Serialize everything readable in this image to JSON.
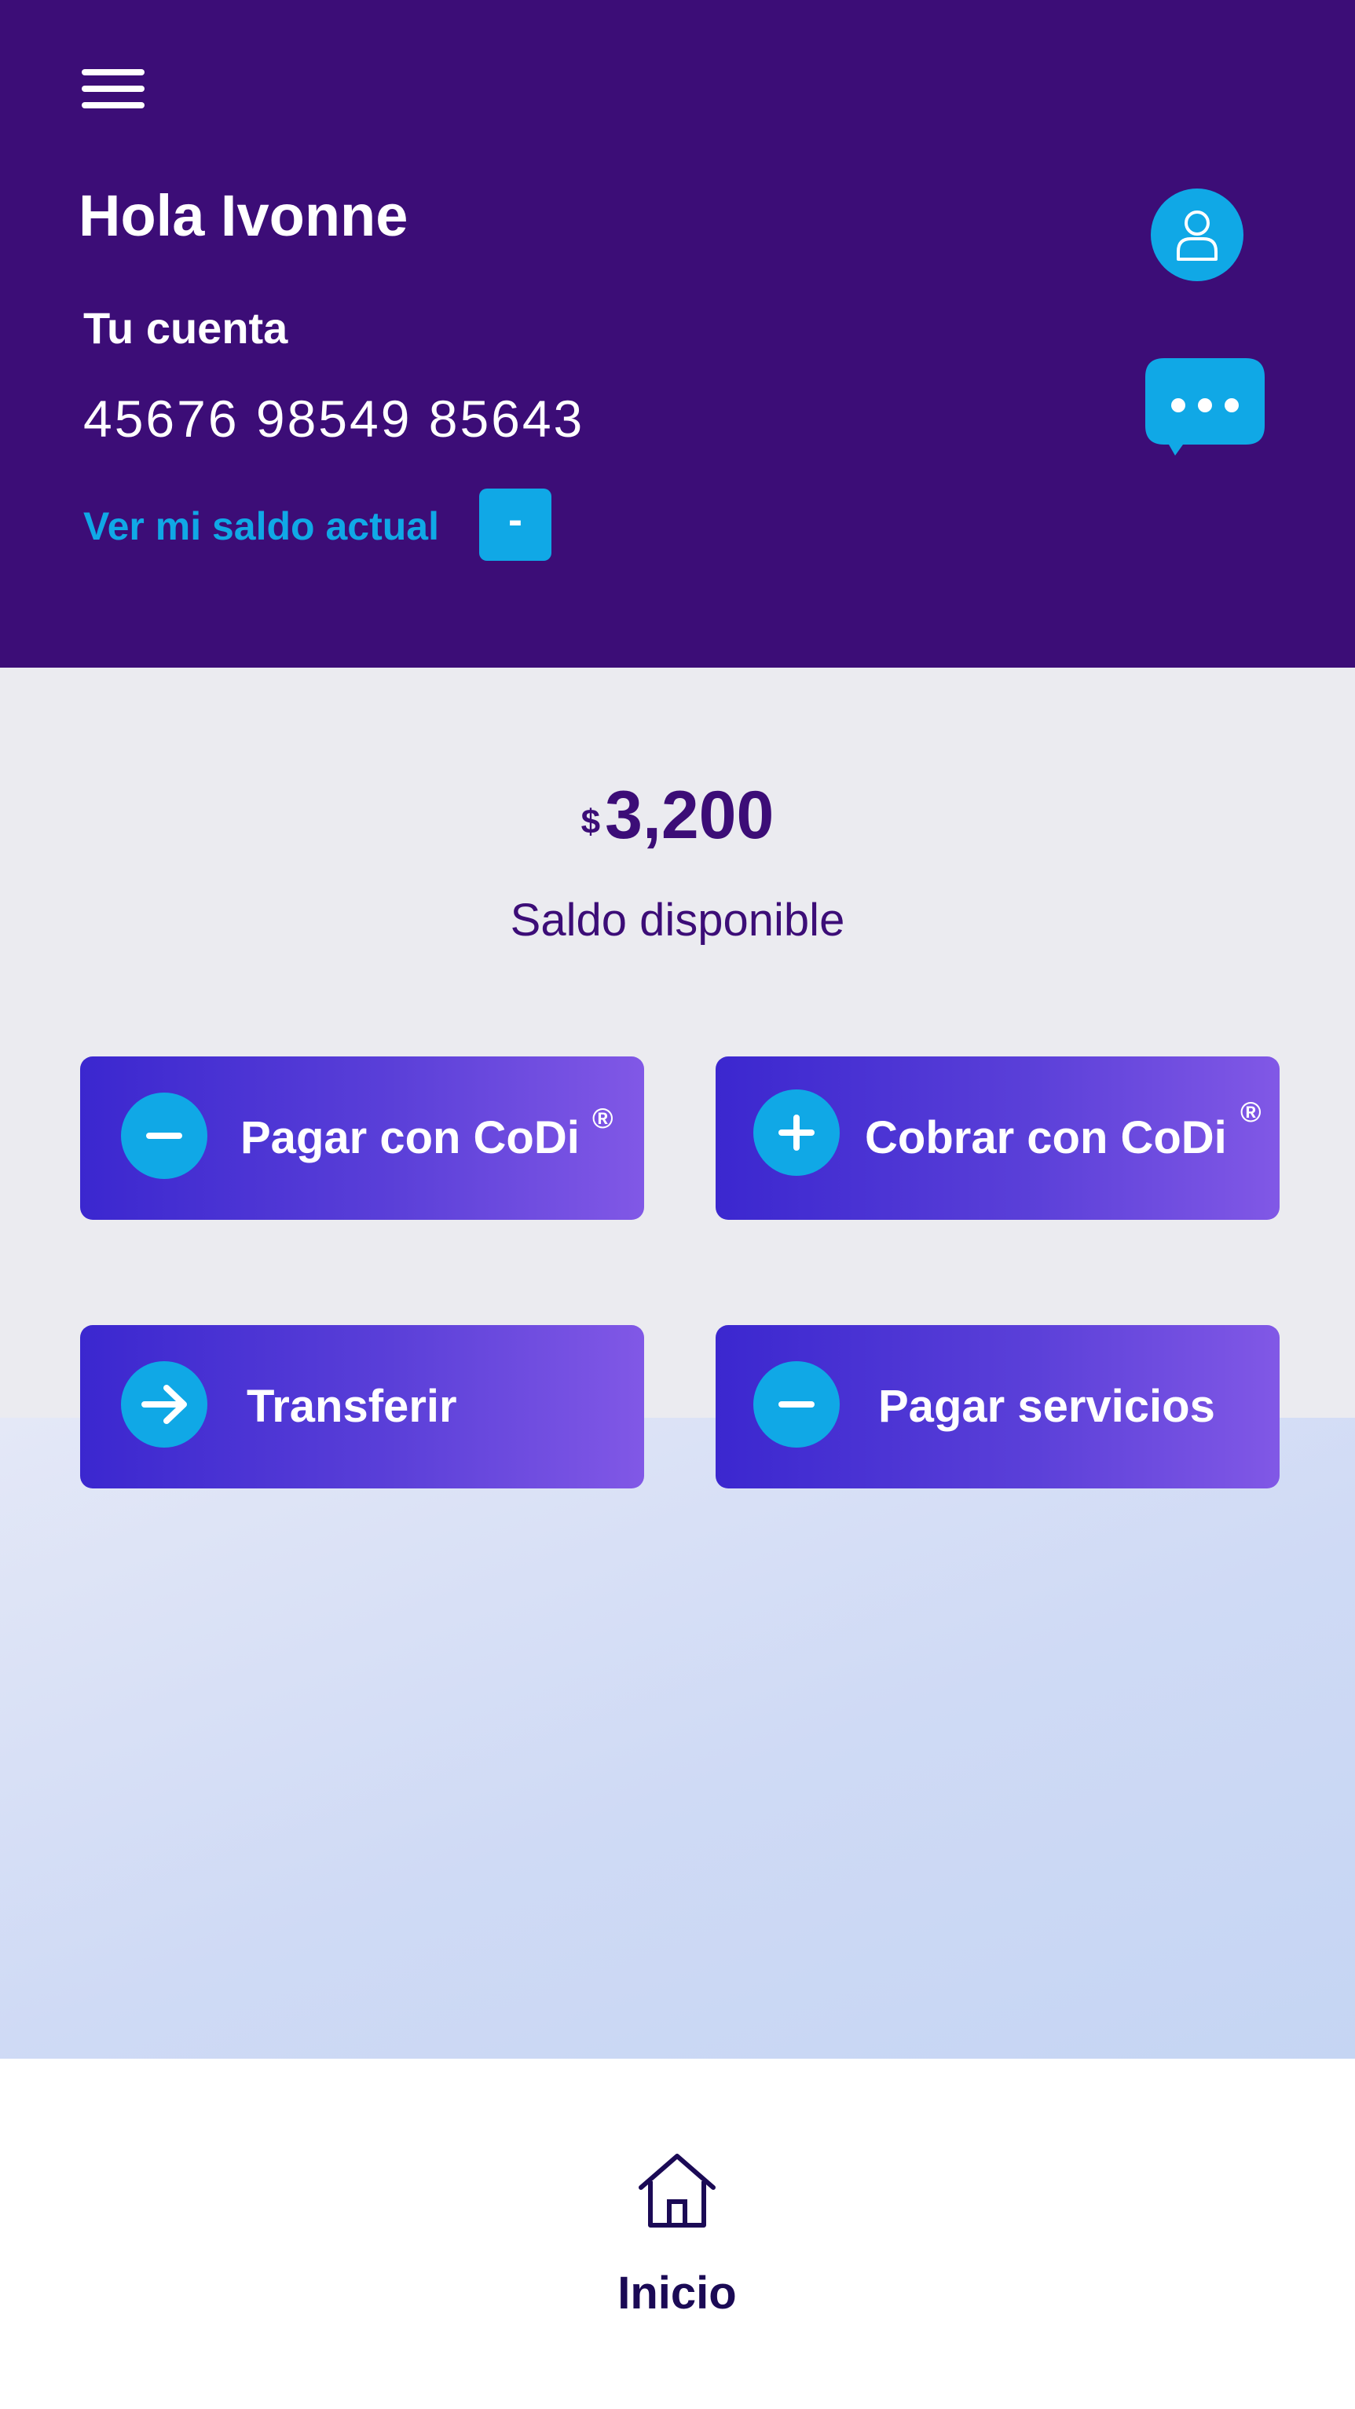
{
  "header": {
    "greeting": "Hola Ivonne",
    "account_label": "Tu cuenta",
    "account_number": "45676 98549 85643",
    "balance_link": "Ver mi saldo actual",
    "toggle_label": "-"
  },
  "balance": {
    "currency": "$",
    "amount": "3,200",
    "caption": "Saldo disponible"
  },
  "actions": [
    {
      "label": "Pagar con CoDi",
      "mark": "®",
      "icon": "minus-icon"
    },
    {
      "label": "Cobrar con CoDi",
      "mark": "®",
      "icon": "plus-icon"
    },
    {
      "label": "Transferir",
      "icon": "arrow-right-icon"
    },
    {
      "label": "Pagar servicios",
      "icon": "minus-icon"
    }
  ],
  "nav": {
    "home_label": "Inicio",
    "home_icon": "home-icon"
  },
  "colors": {
    "header_bg": "#3c0d77",
    "accent": "#10a8e6",
    "button_gradient_start": "#3b27cf",
    "button_gradient_end": "#8158e6",
    "text_dark": "#3c0d77"
  }
}
